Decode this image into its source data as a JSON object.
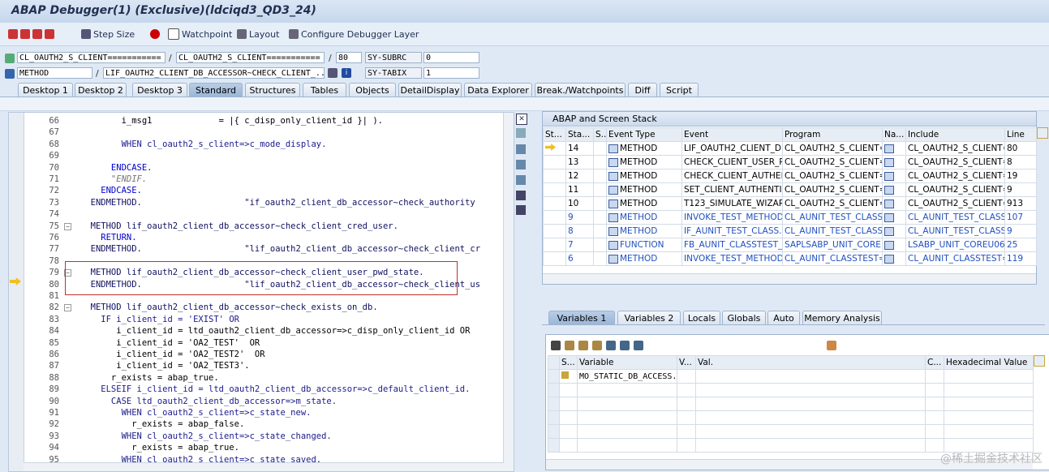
{
  "window": {
    "title": "ABAP Debugger(1)  (Exclusive)(ldciqd3_QD3_24)"
  },
  "toolbar": {
    "step_size": "Step Size",
    "watchpoint": "Watchpoint",
    "layout": "Layout",
    "configure": "Configure Debugger Layer"
  },
  "fields": {
    "row1": {
      "a": "CL_OAUTH2_S_CLIENT===========",
      "b": "CL_OAUTH2_S_CLIENT===========",
      "line": "80",
      "sysvar": "SY-SUBRC",
      "sysval": "0"
    },
    "row2": {
      "a": "METHOD",
      "b": "LIF_OAUTH2_CLIENT_DB_ACCESSOR~CHECK_CLIENT_...",
      "sysvar": "SY-TABIX",
      "sysval": "1"
    }
  },
  "tabs": [
    "Desktop 1",
    "Desktop 2",
    "Desktop 3",
    "Standard",
    "Structures",
    "Tables",
    "Objects",
    "DetailDisplay",
    "Data Explorer",
    "Break./Watchpoints",
    "Diff",
    "Script"
  ],
  "code_lines": [
    {
      "n": "66",
      "code": "        i_msg1             = |{ c_disp_only_client_id }| )."
    },
    {
      "n": "67",
      "code": ""
    },
    {
      "n": "68",
      "code": "        WHEN cl_oauth2_s_client=>c_mode_display."
    },
    {
      "n": "69",
      "code": ""
    },
    {
      "n": "70",
      "code": "      ENDCASE."
    },
    {
      "n": "71",
      "code": "      \"ENDIF."
    },
    {
      "n": "72",
      "code": "    ENDCASE."
    },
    {
      "n": "73",
      "code": "  ENDMETHOD.                    \"if_oauth2_client_db_accessor~check_authority"
    },
    {
      "n": "74",
      "code": ""
    },
    {
      "n": "75",
      "code": "  METHOD lif_oauth2_client_db_accessor~check_client_cred_user."
    },
    {
      "n": "76",
      "code": "    RETURN."
    },
    {
      "n": "77",
      "code": "  ENDMETHOD.                    \"lif_oauth2_client_db_accessor~check_client_cr"
    },
    {
      "n": "78",
      "code": ""
    },
    {
      "n": "79",
      "code": "  METHOD lif_oauth2_client_db_accessor~check_client_user_pwd_state."
    },
    {
      "n": "80",
      "code": "  ENDMETHOD.                    \"lif_oauth2_client_db_accessor~check_client_us"
    },
    {
      "n": "81",
      "code": ""
    },
    {
      "n": "82",
      "code": "  METHOD lif_oauth2_client_db_accessor~check_exists_on_db."
    },
    {
      "n": "83",
      "code": "    IF i_client_id = 'EXIST' OR"
    },
    {
      "n": "84",
      "code": "       i_client_id = ltd_oauth2_client_db_accessor=>c_disp_only_client_id OR"
    },
    {
      "n": "85",
      "code": "       i_client_id = 'OA2_TEST'  OR"
    },
    {
      "n": "86",
      "code": "       i_client_id = 'OA2_TEST2'  OR"
    },
    {
      "n": "87",
      "code": "       i_client_id = 'OA2_TEST3'."
    },
    {
      "n": "88",
      "code": "      r_exists = abap_true."
    },
    {
      "n": "89",
      "code": "    ELSEIF i_client_id = ltd_oauth2_client_db_accessor=>c_default_client_id."
    },
    {
      "n": "90",
      "code": "      CASE ltd_oauth2_client_db_accessor=>m_state."
    },
    {
      "n": "91",
      "code": "        WHEN cl_oauth2_s_client=>c_state_new."
    },
    {
      "n": "92",
      "code": "          r_exists = abap_false."
    },
    {
      "n": "93",
      "code": "        WHEN cl_oauth2_s_client=>c_state_changed."
    },
    {
      "n": "94",
      "code": "          r_exists = abap_true."
    },
    {
      "n": "95",
      "code": "        WHEN cl_oauth2_s_client=>c_state_saved."
    }
  ],
  "stack": {
    "title": "ABAP and Screen Stack",
    "headers": [
      "St...",
      "Sta...",
      "S...",
      "Event Type",
      "Event",
      "Program",
      "Na...",
      "Include",
      "Line"
    ],
    "rows": [
      {
        "st": "",
        "level": "14",
        "type": "METHOD",
        "event": "LIF_OAUTH2_CLIENT_D...",
        "program": "CL_OAUTH2_S_CLIENT=...",
        "include": "CL_OAUTH2_S_CLIENT=...",
        "line": "80"
      },
      {
        "st": "",
        "level": "13",
        "type": "METHOD",
        "event": "CHECK_CLIENT_USER_P...",
        "program": "CL_OAUTH2_S_CLIENT=...",
        "include": "CL_OAUTH2_S_CLIENT=...",
        "line": "8"
      },
      {
        "st": "",
        "level": "12",
        "type": "METHOD",
        "event": "CHECK_CLIENT_AUTHEN...",
        "program": "CL_OAUTH2_S_CLIENT=...",
        "include": "CL_OAUTH2_S_CLIENT=...",
        "line": "19"
      },
      {
        "st": "",
        "level": "11",
        "type": "METHOD",
        "event": "SET_CLIENT_AUTHENTI...",
        "program": "CL_OAUTH2_S_CLIENT=...",
        "include": "CL_OAUTH2_S_CLIENT=...",
        "line": "9"
      },
      {
        "st": "",
        "level": "10",
        "type": "METHOD",
        "event": "T123_SIMULATE_WIZAR...",
        "program": "CL_OAUTH2_S_CLIENT=...",
        "include": "CL_OAUTH2_S_CLIENT=...",
        "line": "913"
      },
      {
        "st": "",
        "level": "9",
        "type": "METHOD",
        "event": "INVOKE_TEST_METHOD",
        "program": "CL_AUNIT_TEST_CLASS...",
        "include": "CL_AUNIT_TEST_CLASS...",
        "line": "107"
      },
      {
        "st": "",
        "level": "8",
        "type": "METHOD",
        "event": "IF_AUNIT_TEST_CLASS...",
        "program": "CL_AUNIT_TEST_CLASS...",
        "include": "CL_AUNIT_TEST_CLASS...",
        "line": "9"
      },
      {
        "st": "",
        "level": "7",
        "type": "FUNCTION",
        "event": "FB_AUNIT_CLASSTEST_...",
        "program": "SAPLSABP_UNIT_CORE",
        "include": "LSABP_UNIT_COREU06",
        "line": "25"
      },
      {
        "st": "",
        "level": "6",
        "type": "METHOD",
        "event": "INVOKE_TEST_METHOD",
        "program": "CL_AUNIT_CLASSTEST=...",
        "include": "CL_AUNIT_CLASSTEST=...",
        "line": "119"
      }
    ]
  },
  "var_tabs": [
    "Variables 1",
    "Variables 2",
    "Locals",
    "Globals",
    "Auto",
    "Memory Analysis"
  ],
  "vars": {
    "headers": [
      "S...",
      "Variable",
      "V...",
      "Val.",
      "C...",
      "Hexadecimal Value"
    ],
    "rows": [
      {
        "variable": "MO_STATIC_DB_ACCESS..."
      }
    ]
  },
  "watermark": "@稀土掘金技术社区"
}
